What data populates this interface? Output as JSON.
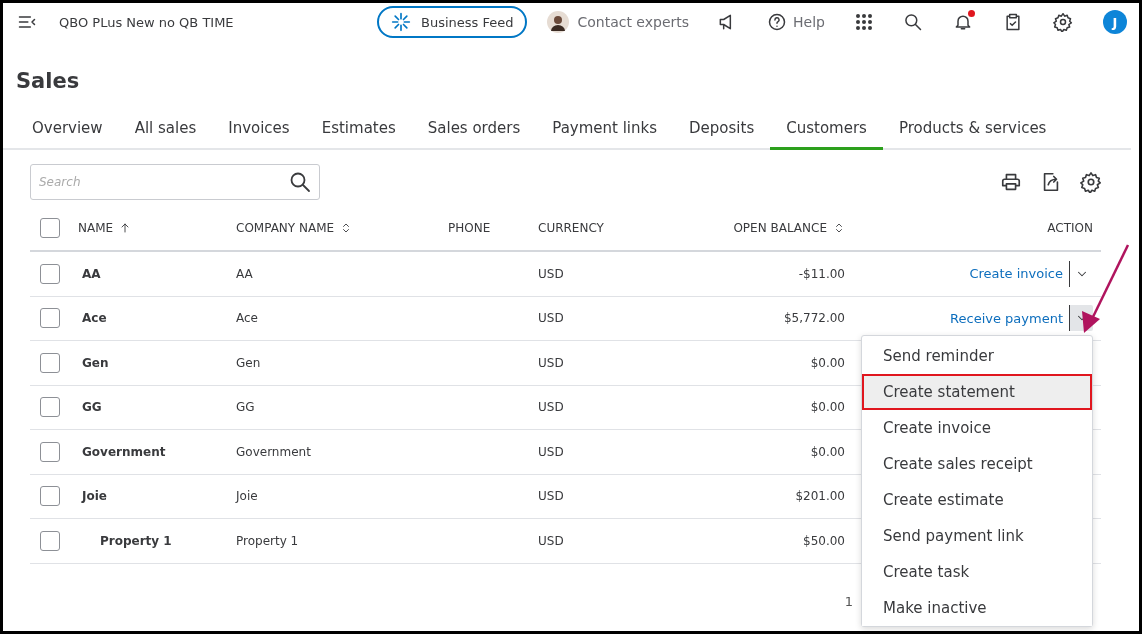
{
  "top_bar": {
    "company": "QBO PLus New no QB TIME",
    "business_feed": "Business Feed",
    "contact": "Contact experts",
    "help": "Help",
    "notification_dot": true,
    "avatar": "J"
  },
  "page_title": "Sales",
  "tabs": [
    {
      "label": "Overview",
      "selected": false
    },
    {
      "label": "All sales",
      "selected": false
    },
    {
      "label": "Invoices",
      "selected": false
    },
    {
      "label": "Estimates",
      "selected": false
    },
    {
      "label": "Sales orders",
      "selected": false
    },
    {
      "label": "Payment links",
      "selected": false
    },
    {
      "label": "Deposits",
      "selected": false
    },
    {
      "label": "Customers",
      "selected": true
    },
    {
      "label": "Products & services",
      "selected": false
    }
  ],
  "search": {
    "placeholder": "Search"
  },
  "table": {
    "select_all_checked": false,
    "columns": [
      {
        "label": "NAME",
        "sorted_ascending": true
      },
      {
        "label": "COMPANY NAME",
        "sortable": true
      },
      {
        "label": "PHONE"
      },
      {
        "label": "CURRENCY"
      },
      {
        "label": "OPEN BALANCE",
        "sortable": true
      },
      {
        "label": "ACTION"
      }
    ],
    "rows": [
      {
        "name": "AA",
        "company": "AA",
        "currency": "USD",
        "balance": "-$11.00",
        "action": "Create invoice",
        "checked": false,
        "expanded": false
      },
      {
        "name": "Ace",
        "company": "Ace",
        "currency": "USD",
        "balance": "$5,772.00",
        "action": "Receive payment",
        "checked": false,
        "expanded": true
      },
      {
        "name": "Gen",
        "company": "Gen",
        "currency": "USD",
        "balance": "$0.00",
        "checked": false
      },
      {
        "name": "GG",
        "company": "GG",
        "currency": "USD",
        "balance": "$0.00",
        "checked": false
      },
      {
        "name": "Government",
        "company": "Government",
        "currency": "USD",
        "balance": "$0.00",
        "checked": false
      },
      {
        "name": "Joie",
        "company": "Joie",
        "currency": "USD",
        "balance": "$201.00",
        "checked": false,
        "children": [
          {
            "name": "Property 1",
            "company": "Property 1",
            "currency": "USD",
            "balance": "$50.00",
            "checked": false
          }
        ]
      }
    ]
  },
  "action_menu": [
    {
      "label": "Send reminder",
      "selected": false,
      "highlighted": false
    },
    {
      "label": "Create statement",
      "selected": true,
      "highlighted": true
    },
    {
      "label": "Create invoice",
      "selected": false,
      "highlighted": false
    },
    {
      "label": "Create sales receipt",
      "selected": false,
      "highlighted": false
    },
    {
      "label": "Create estimate",
      "selected": false,
      "highlighted": false
    },
    {
      "label": "Send payment link",
      "selected": false,
      "highlighted": false
    },
    {
      "label": "Create task",
      "selected": false,
      "highlighted": false
    },
    {
      "label": "Make inactive",
      "selected": false,
      "highlighted": false
    }
  ],
  "pagination": {
    "page": "1"
  },
  "arrow_annotation": {
    "color": "#b0145e"
  }
}
